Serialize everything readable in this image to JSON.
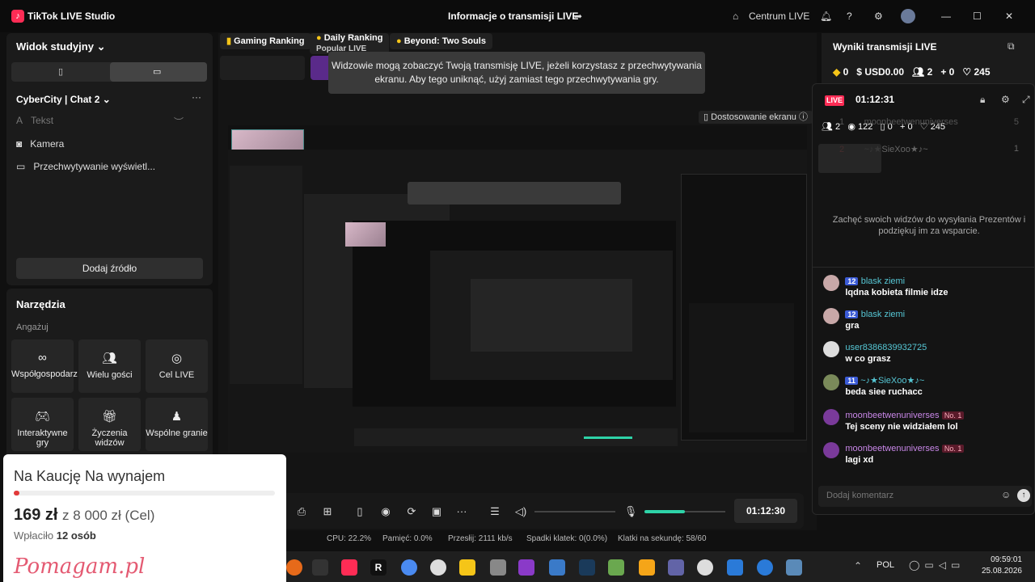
{
  "app": {
    "title": "TikTok LIVE Studio"
  },
  "header": {
    "center_title": "Informacje o transmisji LIVE",
    "centrum": "Centrum LIVE"
  },
  "left": {
    "view_label": "Widok studyjny",
    "scene": "CyberCity | Chat 2",
    "sources": [
      "Tekst",
      "Kamera",
      "Przechwytywanie wyświetl..."
    ],
    "add_source": "Dodaj źródło"
  },
  "tools": {
    "title": "Narzędzia",
    "section": "Angażuj",
    "items": [
      "Współgospodarz",
      "Wielu gości",
      "Cel LIVE",
      "Interaktywne gry",
      "Życzenia widzów",
      "Wspólne granie"
    ]
  },
  "preview": {
    "chips": [
      "Gaming Ranking",
      "Daily Ranking",
      "Beyond: Two Souls"
    ],
    "chip_sub": "Popular LIVE",
    "tooltip": "Widzowie mogą zobaczyć Twoją transmisję LIVE, jeżeli korzystasz z przechwytywania ekranu. Aby tego uniknąć, użyj zamiast tego przechwytywania gry.",
    "screen_adjust": "Dostosowanie ekranu"
  },
  "controls": {
    "timer": "01:12:30",
    "volume_level": 0.5
  },
  "stats": {
    "cpu": "CPU:  22.2%",
    "memory": "Pamięć:  0.0%",
    "upload": "Przesłij:  2111 kb/s",
    "drops": "Spadki klatek:  0(0.0%)",
    "fps": "Klatki na sekundę:  58/60"
  },
  "results": {
    "title": "Wyniki transmisji LIVE",
    "coins": "0",
    "usd": "USD0.00",
    "viewers": "2",
    "follows": "0",
    "likes": "245"
  },
  "live": {
    "badge": "LIVE",
    "time": "01:12:31",
    "viewers": "2",
    "views": "122",
    "gifts": "0",
    "follows": "0",
    "likes": "245",
    "rank": [
      {
        "pos": "1",
        "name": "moonbeetwenuniverses",
        "score": "5"
      },
      {
        "pos": "2",
        "name": "~♪★SieXoo★♪~",
        "score": "1"
      }
    ],
    "empty_text": "Zachęć swoich widzów do wysyłania Prezentów i podziękuj im za wsparcie.",
    "messages": [
      {
        "level": "12",
        "name": "blask ziemi",
        "text": "lqdna kobieta filmie idze"
      },
      {
        "level": "12",
        "name": "blask ziemi",
        "text": "gra"
      },
      {
        "level": "",
        "name": "user8386839932725",
        "text": "w co grasz"
      },
      {
        "level": "11",
        "name": "~♪★SieXoo★♪~",
        "text": "beda siee ruchacc"
      },
      {
        "level": "",
        "name": "moonbeetwenuniverses",
        "badge": "No. 1",
        "text": "Tej sceny nie widziałem lol"
      },
      {
        "level": "",
        "name": "moonbeetwenuniverses",
        "badge": "No. 1",
        "text": "lagi xd"
      }
    ],
    "comment_placeholder": "Dodaj komentarz"
  },
  "donation": {
    "title": "Na Kaucję Na wynajem",
    "amount": "169 zł",
    "goal": "z 8 000 zł (Cel)",
    "donors_label": "Wpłaciło",
    "donors": "12 osób",
    "brand": "Pomagam.pl",
    "progress": 0.021
  },
  "taskbar": {
    "lang": "POL",
    "time": "09:59:01",
    "date": "25.08.2026"
  }
}
